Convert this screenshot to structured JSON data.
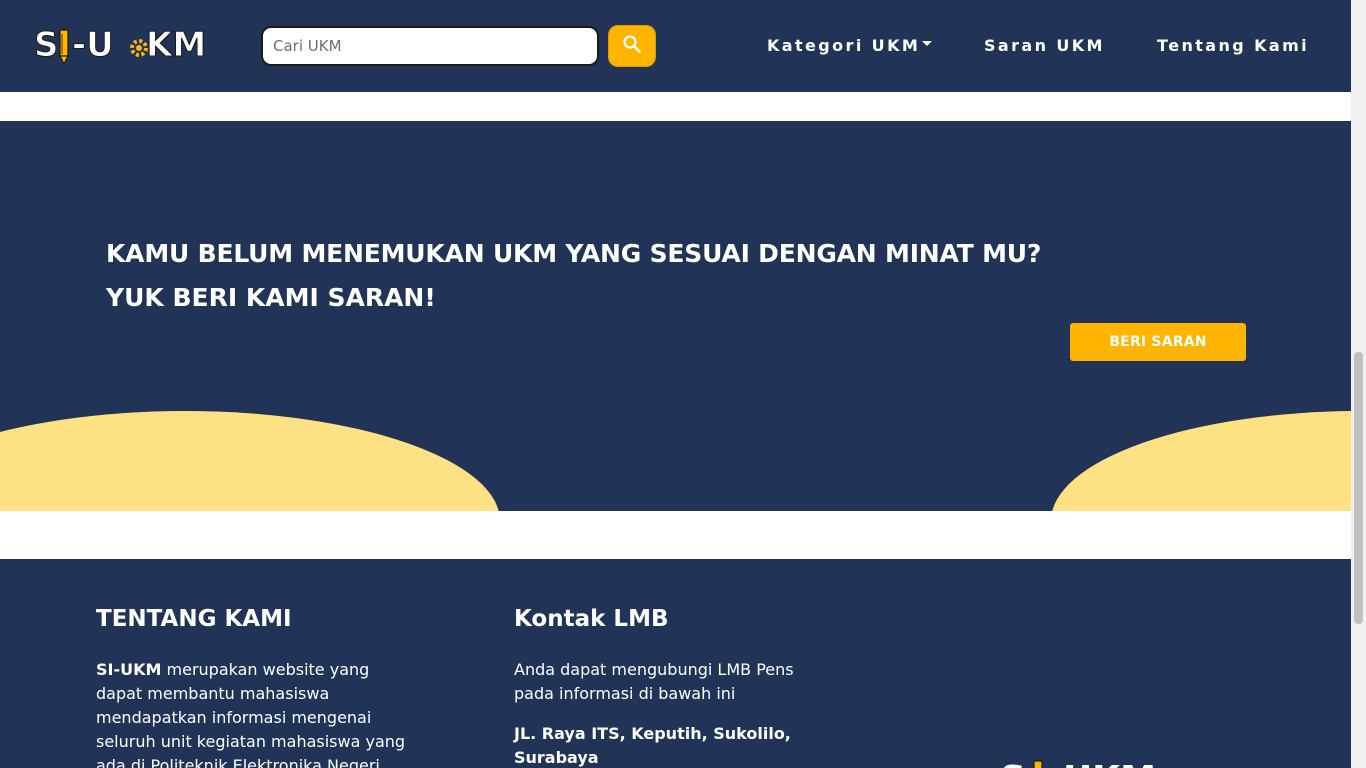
{
  "header": {
    "logo_text": "SI-UKM",
    "search": {
      "placeholder": "Cari UKM",
      "value": ""
    },
    "search_icon": "search-icon",
    "nav": [
      {
        "label": "Kategori UKM",
        "has_dropdown": true
      },
      {
        "label": "Saran UKM"
      },
      {
        "label": "Tentang Kami"
      }
    ]
  },
  "hero": {
    "title": "KAMU BELUM MENEMUKAN UKM YANG SESUAI DENGAN MINAT MU?",
    "subtitle": "YUK BERI KAMI SARAN!",
    "button_label": "BERI SARAN"
  },
  "footer": {
    "about": {
      "heading": "TENTANG KAMI",
      "brand": "SI-UKM",
      "text": " merupakan website yang dapat membantu mahasiswa mendapatkan informasi mengenai seluruh unit kegiatan mahasiswa yang ada di Politeknik Elektronika Negeri"
    },
    "contact": {
      "heading": "Kontak LMB",
      "text": "Anda dapat mengubungi LMB Pens pada informasi di bawah ini",
      "address": "JL. Raya ITS, Keputih, Sukolilo, Surabaya"
    },
    "logo_text": "SI-UKM"
  },
  "colors": {
    "navy": "#213458",
    "accent": "#ffb400",
    "wave": "#fde183",
    "text_light": "#ffffff"
  }
}
